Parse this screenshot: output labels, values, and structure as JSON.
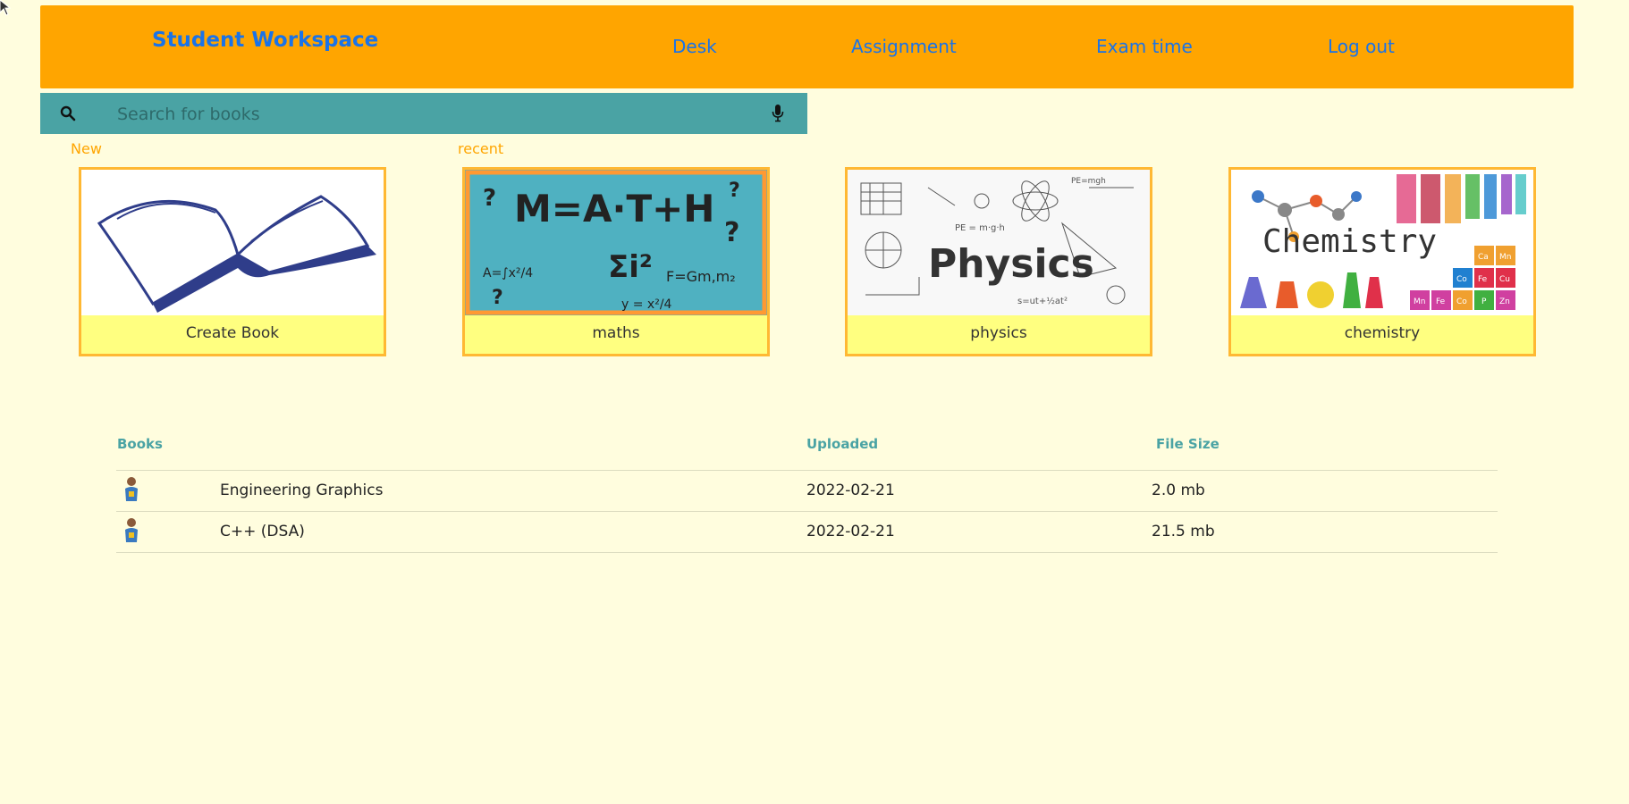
{
  "header": {
    "brand": "Student Workspace",
    "nav": [
      "Desk",
      "Assignment",
      "Exam time",
      "Log out"
    ]
  },
  "search": {
    "placeholder": "Search for books",
    "search_icon": "search-icon",
    "mic_icon": "microphone-icon"
  },
  "sections": {
    "new_label": "New",
    "recent_label": "recent"
  },
  "cards": [
    {
      "label": "Create Book",
      "image": "open-book-illustration"
    },
    {
      "label": "maths",
      "image": "math-formulas-image"
    },
    {
      "label": "physics",
      "image": "physics-sketch-image"
    },
    {
      "label": "chemistry",
      "image": "chemistry-lab-image"
    }
  ],
  "table": {
    "headers": [
      "Books",
      "Uploaded",
      "File Size"
    ],
    "rows": [
      {
        "name": "Engineering Graphics",
        "uploaded": "2022-02-21",
        "size": "2.0 mb"
      },
      {
        "name": "C++ (DSA)",
        "uploaded": "2022-02-21",
        "size": "21.5 mb"
      }
    ]
  },
  "colors": {
    "background": "#fffdde",
    "header": "#ffa500",
    "link": "#1a73e8",
    "search_bar": "#4aa3a4",
    "card_border": "#ffb833",
    "card_caption": "#ffff80"
  }
}
